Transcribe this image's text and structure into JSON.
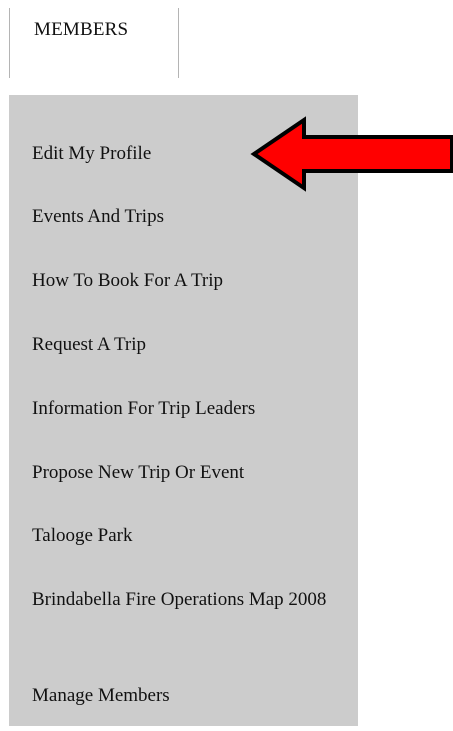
{
  "tab": {
    "label": "MEMBERS"
  },
  "menu": {
    "items": [
      {
        "label": "Edit My Profile"
      },
      {
        "label": "Events And Trips"
      },
      {
        "label": "How To Book For A Trip"
      },
      {
        "label": "Request A Trip"
      },
      {
        "label": "Information For Trip Leaders"
      },
      {
        "label": "Propose New Trip Or Event"
      },
      {
        "label": "Talooge Park"
      },
      {
        "label": "Brindabella Fire Operations Map 2008"
      },
      {
        "label": "Manage Members"
      }
    ]
  },
  "annotation": {
    "arrow_icon": "left-arrow-icon",
    "arrow_color": "#ff0000",
    "arrow_outline": "#000000"
  },
  "colors": {
    "menu_background": "#cccccc",
    "tab_border": "#b4b4b4",
    "text": "#111111"
  }
}
